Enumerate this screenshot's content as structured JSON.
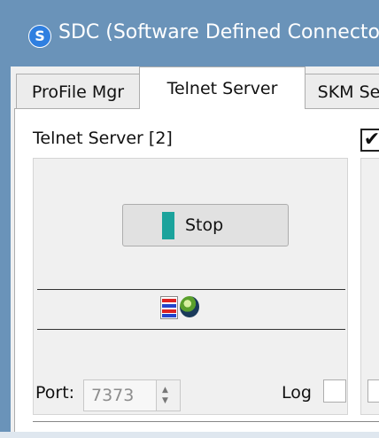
{
  "window": {
    "title": "SDC (Software Defined Connector",
    "app_icon_glyph": "S",
    "colors": {
      "titlebar": "#6a93b9",
      "accent": "#1ba39c"
    }
  },
  "tabs": [
    {
      "label": "ProFile Mgr",
      "active": false
    },
    {
      "label": "Telnet Server",
      "active": true
    },
    {
      "label": "SKM Se",
      "active": false
    }
  ],
  "telnet_server": {
    "title": "Telnet Server [2]",
    "stop_button": {
      "label": "Stop"
    },
    "status_icons": [
      "network-flag-icon",
      "globe-icon"
    ],
    "port": {
      "label": "Port:",
      "value": "7373"
    },
    "log": {
      "label": "Log",
      "checked": false
    }
  },
  "right_panel": {
    "checkbox_glyph": "✔",
    "checked": true
  }
}
